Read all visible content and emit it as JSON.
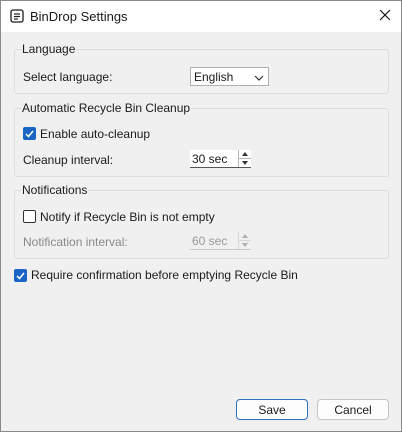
{
  "window": {
    "title": "BinDrop Settings",
    "icons": {
      "app": "document-list-icon",
      "close": "close-icon"
    }
  },
  "language": {
    "group_title": "Language",
    "select_label": "Select language:",
    "selected": "English"
  },
  "cleanup": {
    "group_title": "Automatic Recycle Bin Cleanup",
    "enable_label": "Enable auto-cleanup",
    "enable_checked": true,
    "interval_label": "Cleanup interval:",
    "interval_value": "30 sec"
  },
  "notifications": {
    "group_title": "Notifications",
    "notify_label": "Notify if Recycle Bin is not empty",
    "notify_checked": false,
    "interval_label": "Notification interval:",
    "interval_value": "60 sec"
  },
  "confirm": {
    "label": "Require confirmation before emptying Recycle Bin",
    "checked": true
  },
  "buttons": {
    "save": "Save",
    "cancel": "Cancel"
  },
  "colors": {
    "accent": "#1a66c2",
    "window_bg": "#f0f0f0"
  }
}
